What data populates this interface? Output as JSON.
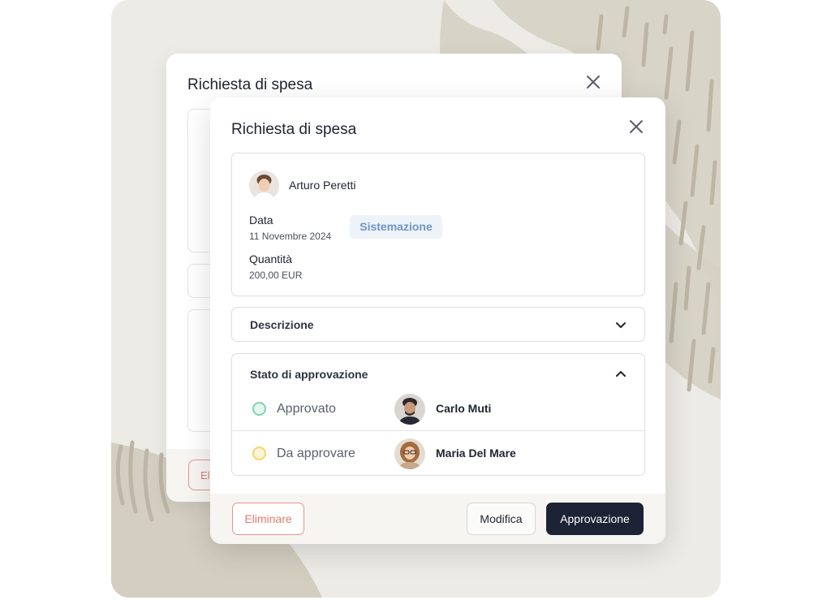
{
  "back_modal": {
    "title": "Richiesta di spesa",
    "delete_label": "El"
  },
  "modal": {
    "title": "Richiesta di spesa",
    "requester": {
      "name": "Arturo Peretti"
    },
    "date": {
      "label": "Data",
      "value": "11 Novembre 2024"
    },
    "category_tag": "Sistemazione",
    "quantity": {
      "label": "Quantità",
      "value": "200,00 EUR"
    },
    "description": {
      "label": "Descrizione"
    },
    "approval": {
      "label": "Stato di approvazione",
      "rows": [
        {
          "status": "Approvato",
          "name": "Carlo Muti",
          "status_color": "#7dd6b4"
        },
        {
          "status": "Da approvare",
          "name": "Maria Del Mare",
          "status_color": "#f3d56a"
        }
      ]
    },
    "footer": {
      "delete_label": "Eliminare",
      "edit_label": "Modifica",
      "approve_label": "Approvazione"
    }
  },
  "icons": [
    "close-icon",
    "chevron-down-icon",
    "chevron-up-icon",
    "avatar"
  ],
  "colors": {
    "primary": "#1d2335",
    "danger": "#e07a6e",
    "tag": "#6f95c8",
    "background": "#ecebe6"
  }
}
